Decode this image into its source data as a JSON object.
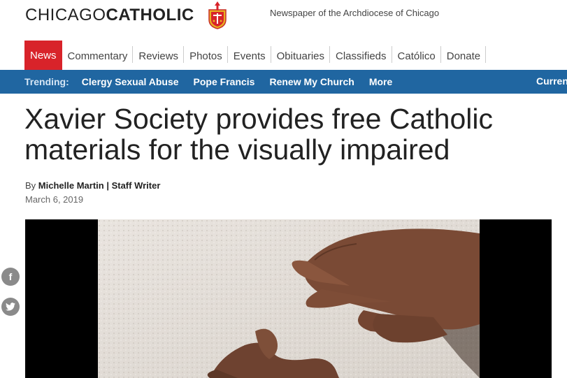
{
  "header": {
    "logo_light": "CHICAGO",
    "logo_bold": "CATHOLIC",
    "tagline": "Newspaper of the Archdiocese of Chicago"
  },
  "nav": {
    "items": [
      {
        "label": "News",
        "active": true
      },
      {
        "label": "Commentary"
      },
      {
        "label": "Reviews"
      },
      {
        "label": "Photos"
      },
      {
        "label": "Events"
      },
      {
        "label": "Obituaries"
      },
      {
        "label": "Classifieds"
      },
      {
        "label": "Católico"
      },
      {
        "label": "Donate"
      }
    ]
  },
  "trending": {
    "label": "Trending:",
    "items": [
      "Clergy Sexual Abuse",
      "Pope Francis",
      "Renew My Church",
      "More"
    ],
    "right_label": "Current"
  },
  "article": {
    "headline": "Xavier Society provides free Catholic materials for the visually impaired",
    "by_prefix": "By",
    "author": "Michelle Martin | Staff Writer",
    "date": "March 6, 2019"
  },
  "social": {
    "facebook_glyph": "f",
    "twitter_glyph": "🐦"
  },
  "colors": {
    "brand_red": "#d8232a",
    "trending_blue": "#2066a1"
  }
}
